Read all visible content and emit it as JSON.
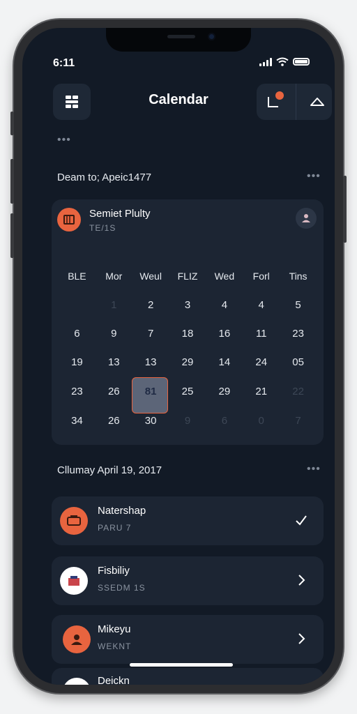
{
  "status_bar": {
    "time": "6:11"
  },
  "header": {
    "title": "Calendar"
  },
  "top_dots": "•••",
  "month_section": {
    "label": "Deam to; Apeic1477",
    "more": "•••"
  },
  "calendar_card": {
    "title": "Semiet Plulty",
    "subtitle": "TE/1S",
    "weekdays": [
      "BLE",
      "Mor",
      "Weul",
      "FLIZ",
      "Wed",
      "Forl",
      "Tins"
    ],
    "weeks": [
      [
        "",
        "1",
        "2",
        "3",
        "4",
        "4",
        "5"
      ],
      [
        "6",
        "9",
        "7",
        "18",
        "16",
        "11",
        "23"
      ],
      [
        "19",
        "13",
        "13",
        "29",
        "14",
        "24",
        "05"
      ],
      [
        "23",
        "26",
        "81",
        "25",
        "29",
        "21",
        "22"
      ],
      [
        "34",
        "26",
        "30",
        "9",
        "6",
        "0",
        "7"
      ]
    ],
    "selected_day": "81"
  },
  "day_section": {
    "label": "Cllumay April 19, 2017",
    "more": "•••"
  },
  "events": [
    {
      "title": "Natershap",
      "subtitle": "PARU 7",
      "action": "check-icon"
    },
    {
      "title": "Fisbiliy",
      "subtitle": "SSEDM 1S",
      "action": "chevron-right-icon"
    },
    {
      "title": "Mikeyu",
      "subtitle": "WEKNT",
      "action": "chevron-right-icon"
    },
    {
      "title": "Deickn",
      "subtitle": "",
      "action": ""
    }
  ],
  "colors": {
    "accent": "#e8643f",
    "background": "#121a26",
    "card": "#1c2533"
  }
}
